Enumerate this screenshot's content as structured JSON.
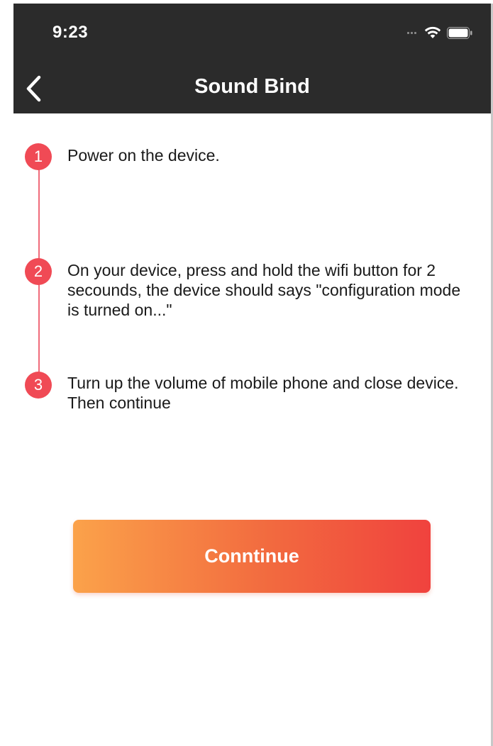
{
  "status_bar": {
    "time": "9:23",
    "icons": [
      "signal-icon",
      "wifi-icon",
      "battery-icon"
    ]
  },
  "nav": {
    "title": "Sound Bind",
    "back_icon": "chevron-left-icon"
  },
  "steps": [
    {
      "number": "1",
      "text": "Power on the device."
    },
    {
      "number": "2",
      "text": "On your device, press and hold the wifi button for 2 secounds, the device should says \"configuration mode is turned on...\""
    },
    {
      "number": "3",
      "text": "Turn up the volume of mobile phone and close device. Then continue"
    }
  ],
  "continue_button": {
    "label": "Conntinue"
  },
  "colors": {
    "header_bg": "#2b2b2b",
    "step_badge": "#f04a55",
    "timeline": "#f06b7a",
    "button_gradient_start": "#fba24a",
    "button_gradient_end": "#f0423e"
  }
}
